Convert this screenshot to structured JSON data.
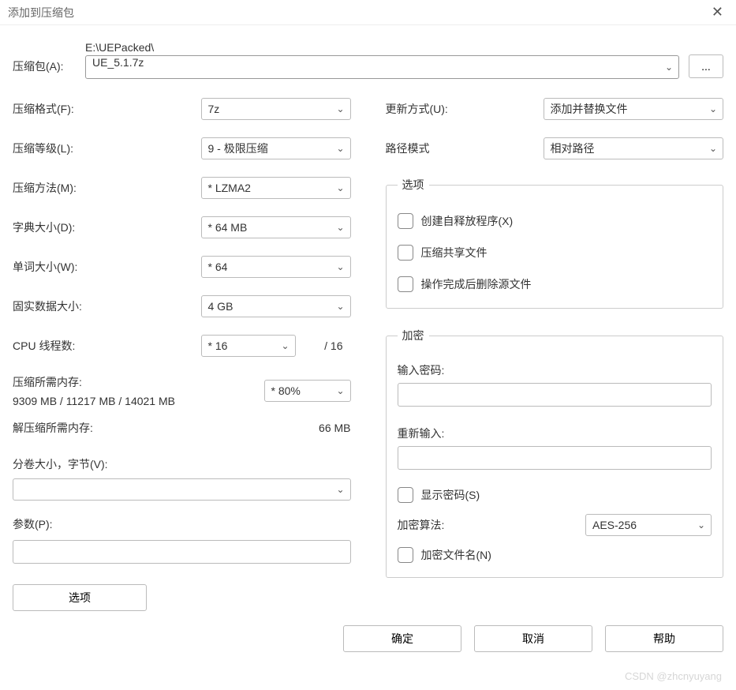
{
  "window": {
    "title": "添加到压缩包"
  },
  "archive": {
    "label": "压缩包(A):",
    "path": "E:\\UEPacked\\",
    "filename": "UE_5.1.7z",
    "browse": "..."
  },
  "left": {
    "format_label": "压缩格式(F):",
    "format_value": "7z",
    "level_label": "压缩等级(L):",
    "level_value": "9 - 极限压缩",
    "method_label": "压缩方法(M):",
    "method_value": "* LZMA2",
    "dict_label": "字典大小(D):",
    "dict_value": "* 64 MB",
    "word_label": "单词大小(W):",
    "word_value": "* 64",
    "solid_label": "固实数据大小:",
    "solid_value": "4 GB",
    "threads_label": "CPU 线程数:",
    "threads_value": "* 16",
    "threads_total": "/ 16",
    "compress_mem_label": "压缩所需内存:",
    "compress_mem_value": "9309 MB / 11217 MB / 14021 MB",
    "mem_percent": "* 80%",
    "decompress_mem_label": "解压缩所需内存:",
    "decompress_mem_value": "66 MB",
    "volume_label": "分卷大小，字节(V):",
    "volume_value": "",
    "params_label": "参数(P):",
    "params_value": "",
    "options_btn": "选项"
  },
  "right": {
    "update_label": "更新方式(U):",
    "update_value": "添加并替换文件",
    "path_mode_label": "路径模式",
    "path_mode_value": "相对路径",
    "options_legend": "选项",
    "opt_sfx": "创建自释放程序(X)",
    "opt_shared": "压缩共享文件",
    "opt_delete": "操作完成后删除源文件",
    "enc_legend": "加密",
    "pwd_label": "输入密码:",
    "pwd2_label": "重新输入:",
    "show_pwd": "显示密码(S)",
    "algo_label": "加密算法:",
    "algo_value": "AES-256",
    "encrypt_names": "加密文件名(N)"
  },
  "buttons": {
    "ok": "确定",
    "cancel": "取消",
    "help": "帮助"
  },
  "watermark": "CSDN @zhcnyuyang"
}
